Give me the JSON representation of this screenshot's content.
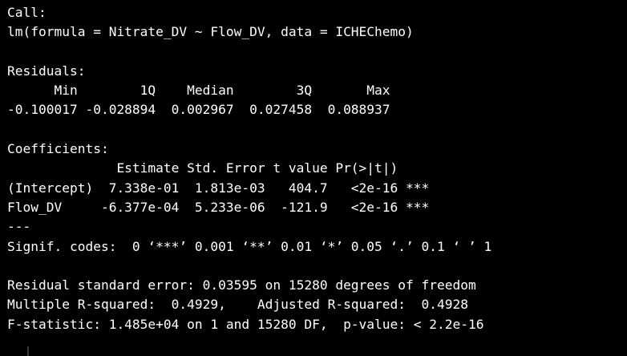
{
  "colors": {
    "background": "#000000",
    "text": "#ffffff"
  },
  "output": {
    "call_header": "Call:",
    "call_formula": "lm(formula = Nitrate_DV ~ Flow_DV, data = ICHEChemo)",
    "residuals_header": "Residuals:",
    "residuals_columns": "      Min        1Q    Median        3Q       Max",
    "residuals_values": "-0.100017 -0.028894  0.002967  0.027458  0.088937",
    "coefficients_header": "Coefficients:",
    "coefficients_columns": "              Estimate Std. Error t value Pr(>|t|)",
    "coef_intercept": "(Intercept)  7.338e-01  1.813e-03   404.7   <2e-16 ***",
    "coef_flow": "Flow_DV     -6.377e-04  5.233e-06  -121.9   <2e-16 ***",
    "separator": "---",
    "signif_codes": "Signif. codes:  0 ‘***’ 0.001 ‘**’ 0.01 ‘*’ 0.05 ‘.’ 0.1 ‘ ’ 1",
    "residual_se": "Residual standard error: 0.03595 on 15280 degrees of freedom",
    "r_squared": "Multiple R-squared:  0.4929,    Adjusted R-squared:  0.4928",
    "f_statistic": "F-statistic: 1.485e+04 on 1 and 15280 DF,  p-value: < 2.2e-16"
  }
}
